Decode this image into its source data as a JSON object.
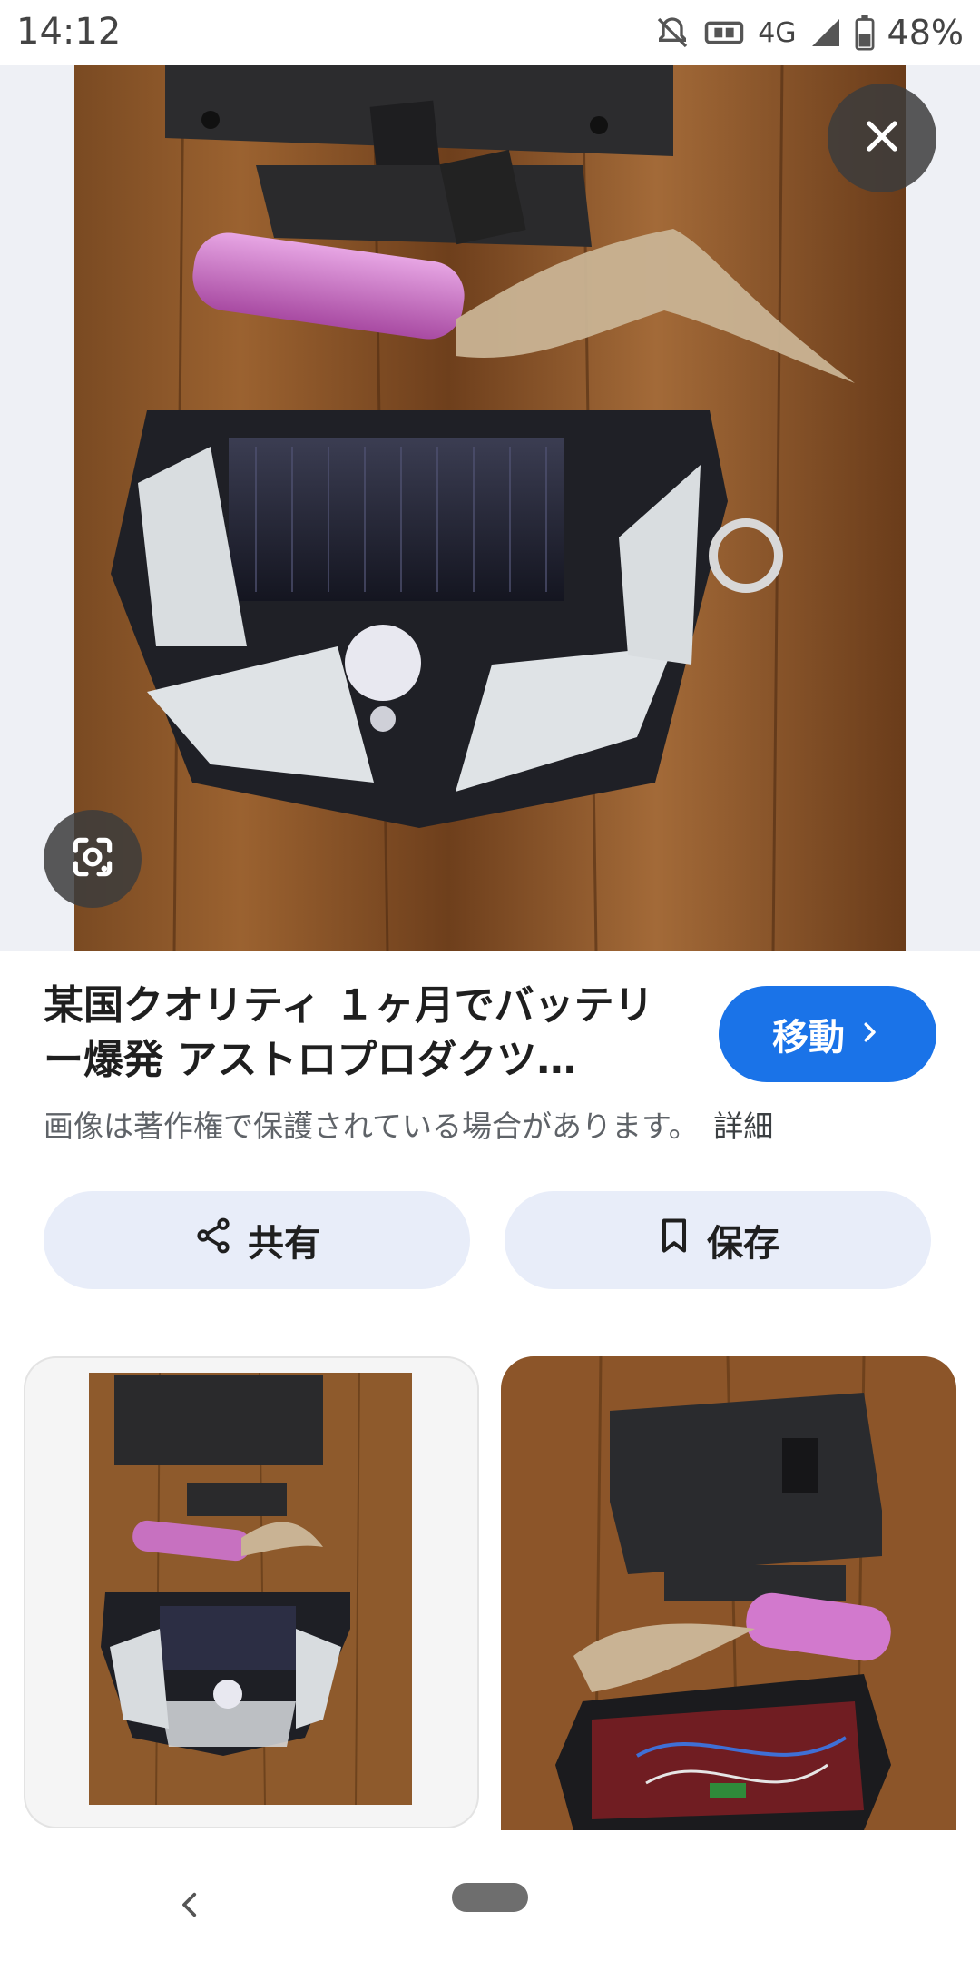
{
  "status": {
    "time": "14:12",
    "network": "4G",
    "battery": "48%"
  },
  "result": {
    "title": "某国クオリティ １ヶ月でバッテリー爆発 アストロプロダクツ…",
    "visit_label": "移動",
    "copyright": "画像は著作権で保護されている場合があります。",
    "details_link": "詳細"
  },
  "actions": {
    "share_label": "共有",
    "save_label": "保存"
  },
  "icons": {
    "close": "close-icon",
    "lens": "google-lens-icon",
    "share": "share-icon",
    "bookmark": "bookmark-icon",
    "visit": "chevron-right-icon",
    "back": "back-icon"
  },
  "colors": {
    "accent": "#1a73e8",
    "pill_bg": "#e8edf9"
  }
}
